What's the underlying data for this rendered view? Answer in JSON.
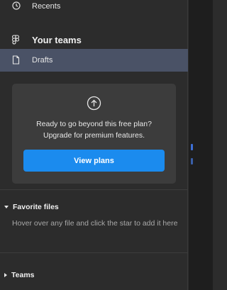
{
  "nav": {
    "recents_label": "Recents",
    "your_teams_label": "Your teams",
    "drafts_label": "Drafts"
  },
  "upsell": {
    "line1": "Ready to go beyond this free plan?",
    "line2": "Upgrade for premium features.",
    "button_label": "View plans"
  },
  "favorites": {
    "header": "Favorite files",
    "hint": "Hover over any file and click the star to add it here"
  },
  "teams_section": {
    "header": "Teams"
  },
  "colors": {
    "sidebar_bg": "#2c2c2c",
    "selected_row": "#4a5266",
    "card_bg": "#3c3c3c",
    "accent_blue": "#1b8bee"
  },
  "icons": {
    "recents": "clock-icon",
    "your_teams": "figma-logo-icon",
    "drafts": "file-icon",
    "upsell": "arrow-up-circle-icon"
  }
}
